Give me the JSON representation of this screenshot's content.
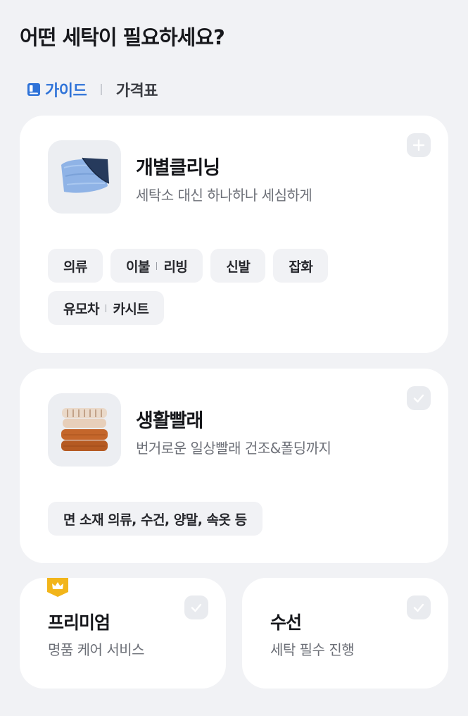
{
  "header": {
    "title": "어떤 세탁이 필요하세요?"
  },
  "tabs": [
    {
      "label": "가이드",
      "active": true,
      "icon": "book-icon"
    },
    {
      "label": "가격표",
      "active": false
    }
  ],
  "services": {
    "individual": {
      "title": "개별클리닝",
      "subtitle": "세탁소 대신 하나하나 세심하게",
      "action_icon": "plus-icon",
      "thumbnail": "comforter-image",
      "chips": [
        {
          "label": "의류"
        },
        {
          "parts": [
            "이불",
            "리빙"
          ]
        },
        {
          "label": "신발"
        },
        {
          "label": "잡화"
        },
        {
          "parts": [
            "유모차",
            "카시트"
          ]
        }
      ]
    },
    "daily": {
      "title": "생활빨래",
      "subtitle": "번거로운 일상빨래 건조&폴딩까지",
      "action_icon": "check-icon",
      "thumbnail": "folded-towels-image",
      "chips": [
        {
          "label": "면 소재 의류, 수건, 양말, 속옷 등"
        }
      ]
    },
    "premium": {
      "title": "프리미엄",
      "subtitle": "명품 케어 서비스",
      "badge_icon": "crown-icon",
      "action_icon": "check-icon"
    },
    "repair": {
      "title": "수선",
      "subtitle": "세탁 필수 진행",
      "action_icon": "check-icon"
    }
  },
  "colors": {
    "accent": "#2f73d8",
    "badge": "#f2b51a",
    "background": "#f1f2f5"
  }
}
